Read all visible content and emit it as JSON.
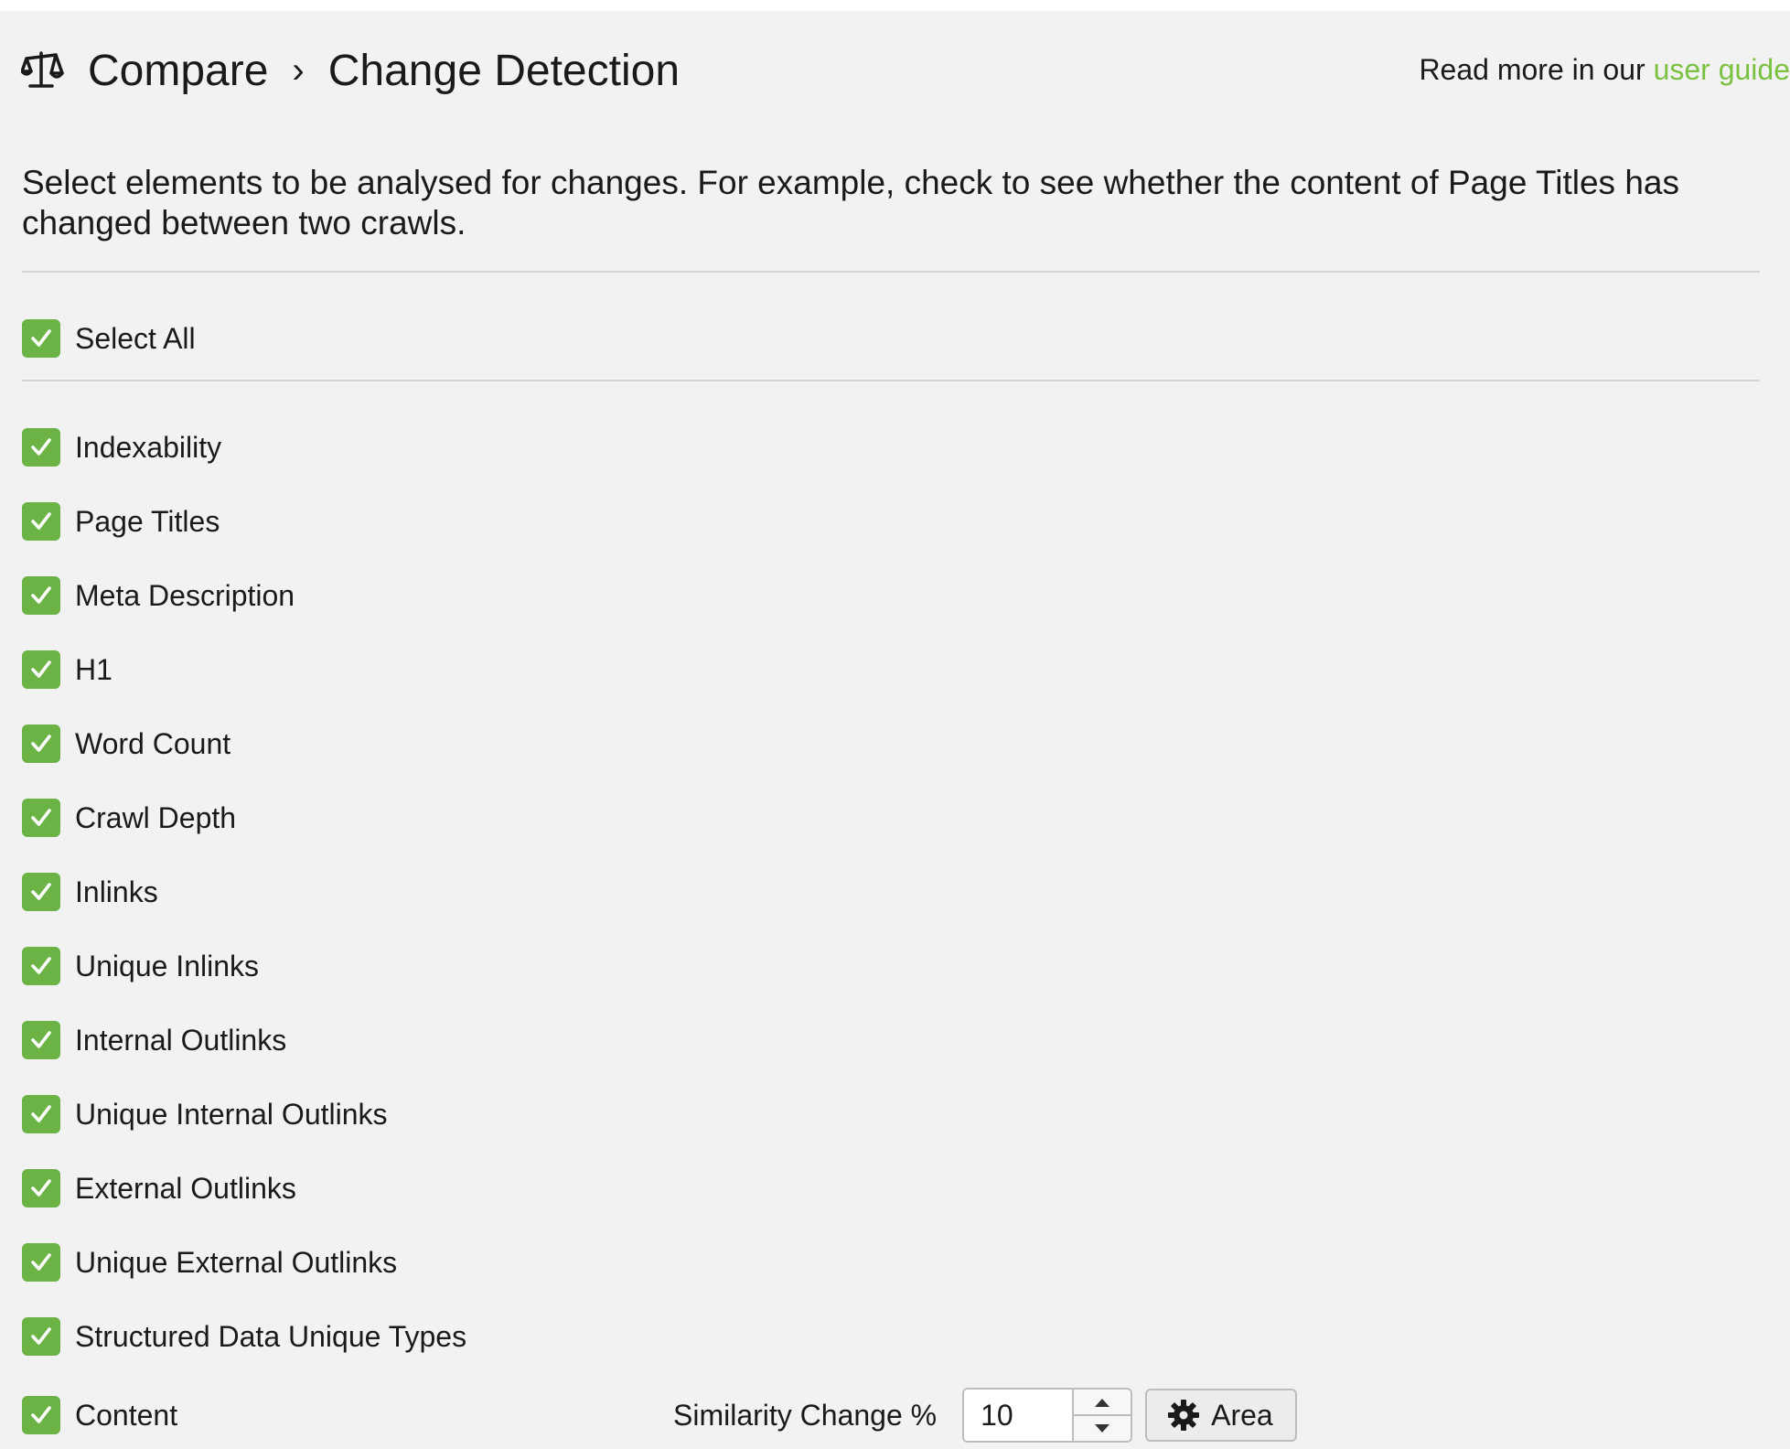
{
  "header": {
    "icon": "balance-scale-icon",
    "crumb_parent": "Compare",
    "crumb_separator": "›",
    "crumb_current": "Change Detection",
    "guide_prefix": "Read more in our ",
    "guide_link": "user guide"
  },
  "description": "Select elements to be analysed for changes. For example, check to see whether the content of Page Titles has changed between two crawls.",
  "select_all": {
    "label": "Select All",
    "checked": true
  },
  "elements": [
    {
      "label": "Indexability",
      "checked": true
    },
    {
      "label": "Page Titles",
      "checked": true
    },
    {
      "label": "Meta Description",
      "checked": true
    },
    {
      "label": "H1",
      "checked": true
    },
    {
      "label": "Word Count",
      "checked": true
    },
    {
      "label": "Crawl Depth",
      "checked": true
    },
    {
      "label": "Inlinks",
      "checked": true
    },
    {
      "label": "Unique Inlinks",
      "checked": true
    },
    {
      "label": "Internal Outlinks",
      "checked": true
    },
    {
      "label": "Unique Internal Outlinks",
      "checked": true
    },
    {
      "label": "External Outlinks",
      "checked": true
    },
    {
      "label": "Unique External Outlinks",
      "checked": true
    },
    {
      "label": "Structured Data Unique Types",
      "checked": true
    },
    {
      "label": "Content",
      "checked": true
    }
  ],
  "similarity": {
    "label": "Similarity Change %",
    "value": "10",
    "area_button": "Area",
    "area_icon": "gear-icon"
  },
  "colors": {
    "checkbox": "#6ab344",
    "link": "#7bc142",
    "panel_bg": "#f2f2f2"
  }
}
